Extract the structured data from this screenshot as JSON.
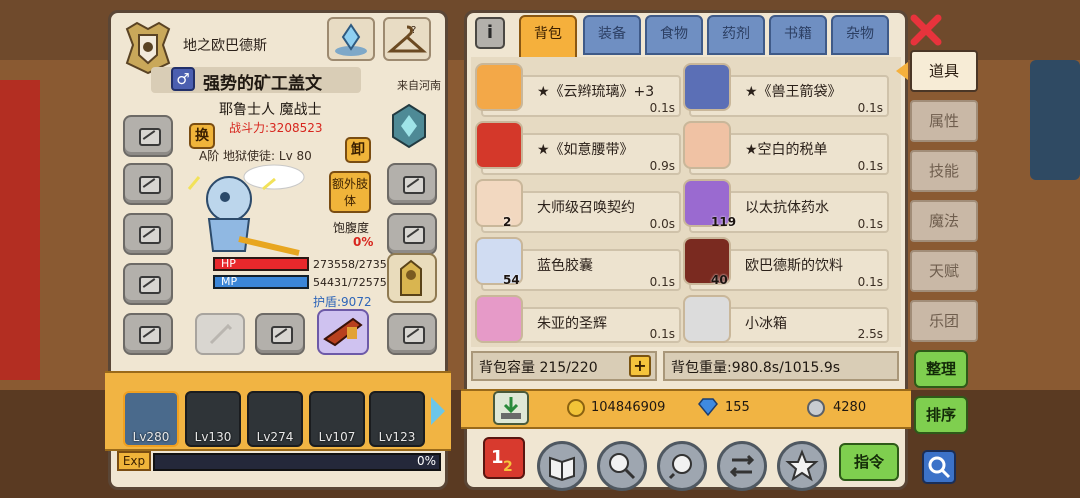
{
  "character": {
    "title": "地之欧巴德斯",
    "name": "强势的矿工盖文",
    "origin": "来自河南",
    "class": "耶鲁士人 魔战士",
    "power": "战斗力:3208523",
    "rank": "A阶 地狱使徒: Lv 80",
    "swap_label": "换",
    "unequip_label": "卸",
    "extra_body_label": "额外肢体",
    "satiety_label": "饱腹度",
    "satiety_value": "0%",
    "hp_label": "HP",
    "hp_value": "273558/2735",
    "mp_label": "MP",
    "mp_value": "54431/72575",
    "shield": "护盾:9072"
  },
  "heroes": [
    {
      "level": "Lv280"
    },
    {
      "level": "Lv130"
    },
    {
      "level": "Lv274"
    },
    {
      "level": "Lv107"
    },
    {
      "level": "Lv123"
    }
  ],
  "exp": {
    "label": "Exp",
    "value": "0%",
    "progress": 0
  },
  "inventory": {
    "tabs": [
      "背包",
      "装备",
      "食物",
      "药剂",
      "书籍",
      "杂物"
    ],
    "active_tab": "背包",
    "items": [
      {
        "name": "★《云辫琉璃》+3",
        "weight": "0.1s",
        "count": ""
      },
      {
        "name": "★《兽王箭袋》",
        "weight": "0.1s",
        "count": ""
      },
      {
        "name": "★《如意腰带》",
        "weight": "0.9s",
        "count": ""
      },
      {
        "name": "★空白的税单",
        "weight": "0.1s",
        "count": ""
      },
      {
        "name": "大师级召唤契约",
        "weight": "0.0s",
        "count": "2"
      },
      {
        "name": "以太抗体药水",
        "weight": "0.1s",
        "count": "119"
      },
      {
        "name": "蓝色胶囊",
        "weight": "0.1s",
        "count": "54"
      },
      {
        "name": "欧巴德斯的饮料",
        "weight": "0.1s",
        "count": "40"
      },
      {
        "name": "朱亚的圣辉",
        "weight": "0.1s",
        "count": ""
      },
      {
        "name": "小冰箱",
        "weight": "2.5s",
        "count": ""
      }
    ],
    "capacity": "背包容量 215/220",
    "weight": "背包重量:980.8s/1015.9s",
    "gold": "104846909",
    "diamond": "155",
    "silver": "4280",
    "command_label": "指令"
  },
  "side_menu": {
    "items": [
      "道具",
      "属性",
      "技能",
      "魔法",
      "天赋",
      "乐团"
    ],
    "active": "道具",
    "sort_label": "整理",
    "order_label": "排序"
  },
  "colors": {
    "panel_bg": "#f0e6d2",
    "accent_orange": "#f5b03c",
    "tab_blue": "#6f8fc2",
    "green": "#7fcf4f",
    "close_red": "#e8333c",
    "power_red": "#d7261e"
  }
}
